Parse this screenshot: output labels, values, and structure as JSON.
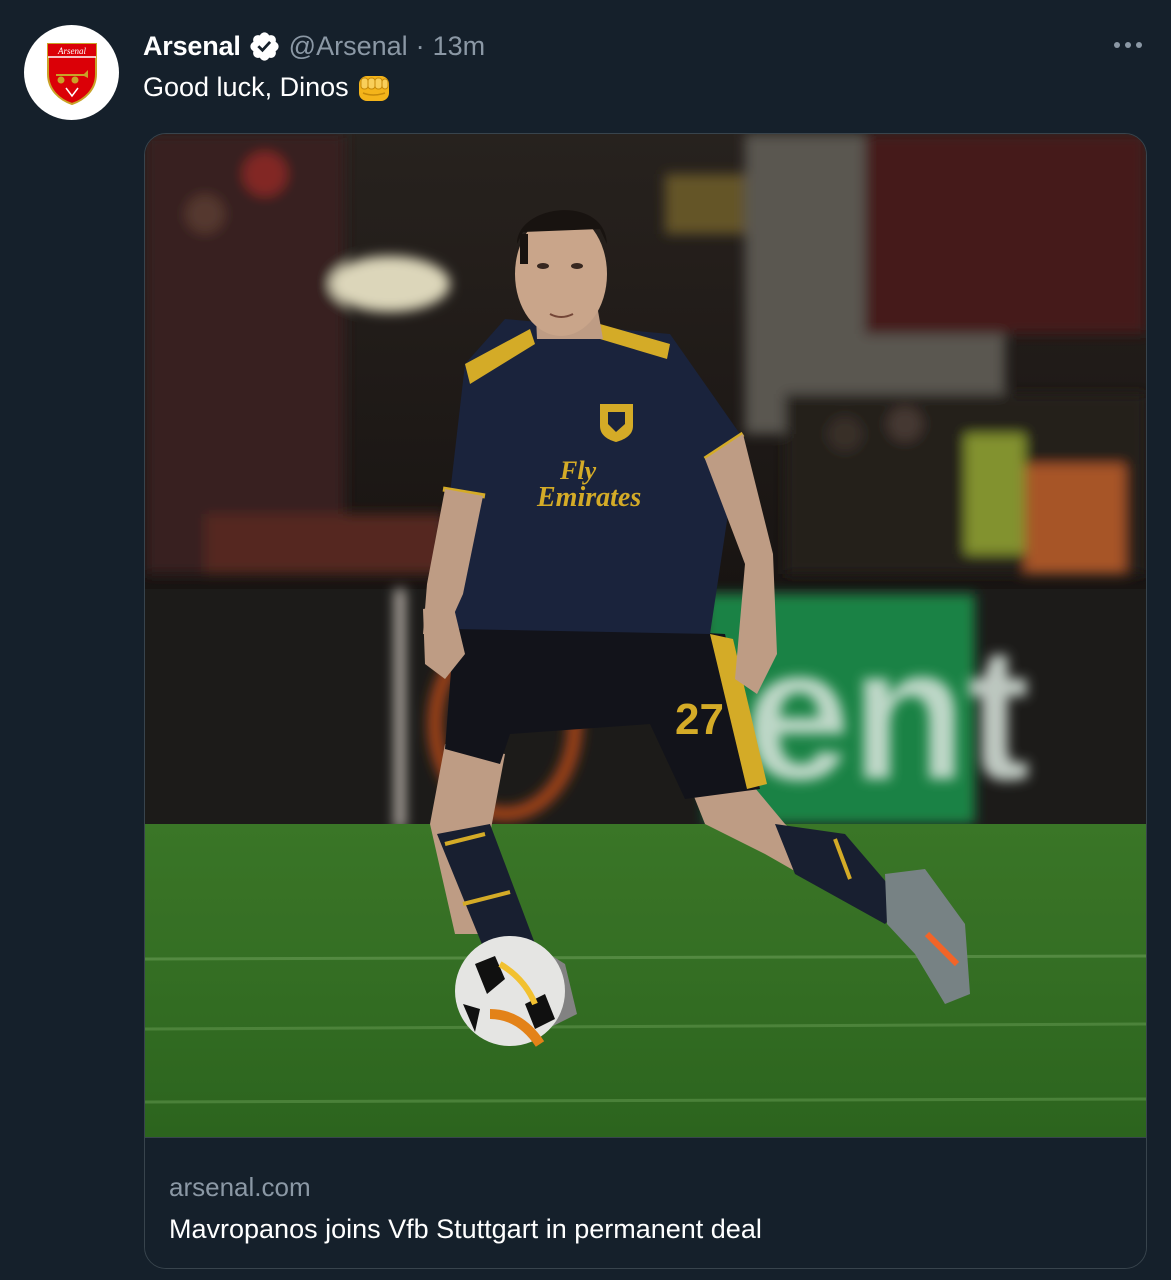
{
  "tweet": {
    "display_name": "Arsenal",
    "handle": "@Arsenal",
    "separator": "·",
    "time": "13m",
    "text": "Good luck, Dinos",
    "avatar_text": "Arsenal",
    "emoji_icon": "oncoming-fist-icon",
    "verified_icon": "verified-badge-icon",
    "more_icon": "more-options-icon"
  },
  "card": {
    "domain": "arsenal.com",
    "title": "Mavropanos joins Vfb Stuttgart in permanent deal",
    "image": {
      "jersey_sponsor_line1": "Fly",
      "jersey_sponsor_line2": "Emirates",
      "shirt_number": "27",
      "board_text": "ent"
    }
  },
  "colors": {
    "background": "#15202b",
    "secondary_text": "#8b98a5",
    "border": "#38444d",
    "verified_badge": "#ffffff",
    "arsenal_red": "#db0007"
  }
}
